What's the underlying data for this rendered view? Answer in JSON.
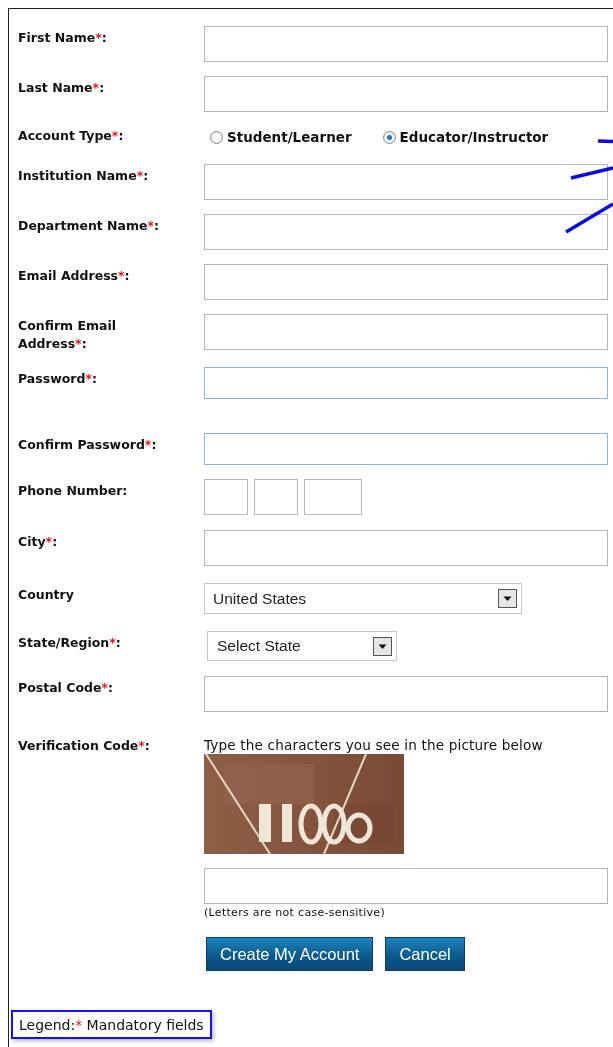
{
  "form": {
    "rows": [
      {
        "kind": "text",
        "label": "First Name",
        "mark": "*",
        "colon": ":",
        "highlighted": false
      },
      {
        "kind": "text",
        "label": "Last Name",
        "mark": "*",
        "colon": ":",
        "highlighted": false
      },
      {
        "kind": "radio",
        "label": "Account Type",
        "mark": "*",
        "colon": ":",
        "options": [
          {
            "label": "Student/Learner",
            "selected": false
          },
          {
            "label": "Educator/Instructor",
            "selected": true
          }
        ]
      },
      {
        "kind": "text",
        "label": "Institution Name",
        "mark": "*",
        "colon": ":",
        "highlighted": false
      },
      {
        "kind": "text",
        "label": "Department Name",
        "mark": "*",
        "colon": ":",
        "highlighted": false
      },
      {
        "kind": "text",
        "label": "Email Address",
        "mark": "*",
        "colon": ":",
        "highlighted": false
      },
      {
        "kind": "text",
        "label": "Confirm Email Address",
        "mark": "*",
        "colon": ":",
        "highlighted": false
      },
      {
        "kind": "password",
        "label": "Password",
        "mark": "*",
        "colon": ":",
        "highlighted": true
      },
      {
        "kind": "text",
        "label": "Confirm Password",
        "mark": "*",
        "colon": ":",
        "highlighted": true
      },
      {
        "kind": "phone",
        "label": "Phone Number",
        "colon": ":"
      },
      {
        "kind": "text",
        "label": "City",
        "mark": "*",
        "colon": ":",
        "highlighted": false
      },
      {
        "kind": "select",
        "label": "Country",
        "value": "United States"
      },
      {
        "kind": "select",
        "label": "State/Region",
        "mark": "*",
        "colon": ":",
        "value": "Select State"
      },
      {
        "kind": "text",
        "label": "Postal Code",
        "mark": "*",
        "colon": ":",
        "highlighted": false
      },
      {
        "kind": "verification",
        "label": "Verification Code",
        "mark": "*",
        "colon": ":",
        "instruction": "Type the characters you see in the picture below",
        "note": "(Letters are not case-sensitive)"
      }
    ],
    "buttons": [
      {
        "label": "Create My Account"
      },
      {
        "label": "Cancel"
      }
    ],
    "legend": {
      "label": "Legend:",
      "mark": "*",
      "text": " Mandatory fields"
    }
  }
}
